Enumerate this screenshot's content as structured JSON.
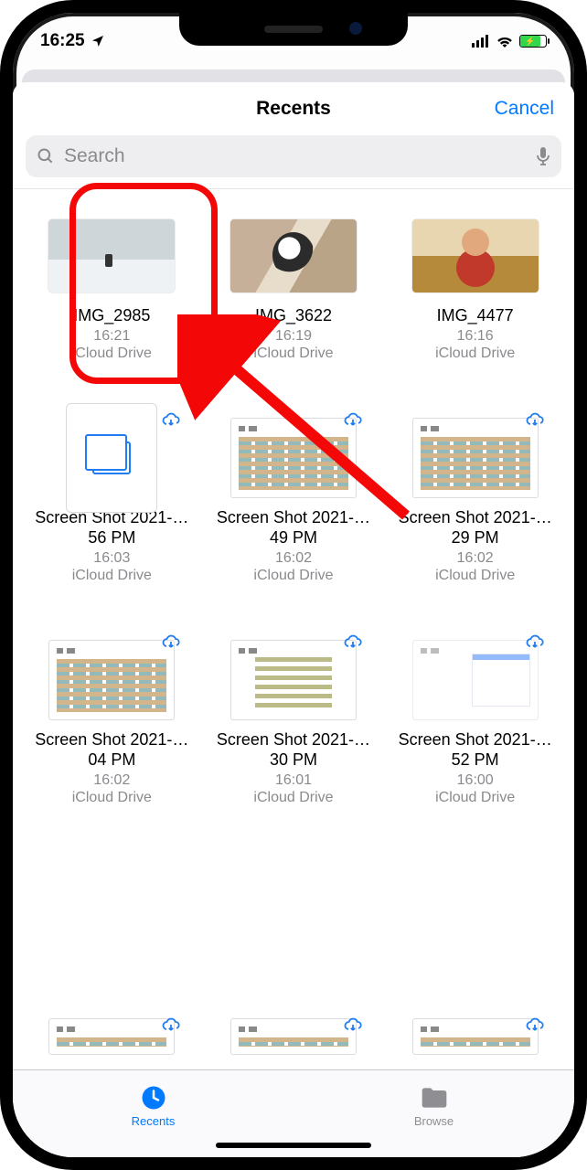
{
  "status": {
    "time": "16:25"
  },
  "nav": {
    "title": "Recents",
    "cancel": "Cancel"
  },
  "search": {
    "placeholder": "Search"
  },
  "files": [
    {
      "name": "IMG_2985",
      "time": "16:21",
      "loc": "iCloud Drive",
      "thumb": "snow",
      "cloud": false,
      "highlighted": true
    },
    {
      "name": "IMG_3622",
      "time": "16:19",
      "loc": "iCloud Drive",
      "thumb": "dog",
      "cloud": false
    },
    {
      "name": "IMG_4477",
      "time": "16:16",
      "loc": "iCloud Drive",
      "thumb": "person",
      "cloud": false
    },
    {
      "name": "Screen Shot 2021-…56 PM",
      "time": "16:03",
      "loc": "iCloud Drive",
      "thumb": "doc",
      "cloud": true
    },
    {
      "name": "Screen Shot 2021-…49 PM",
      "time": "16:02",
      "loc": "iCloud Drive",
      "thumb": "shot-rows",
      "cloud": true
    },
    {
      "name": "Screen Shot 2021-…29 PM",
      "time": "16:02",
      "loc": "iCloud Drive",
      "thumb": "shot-rows",
      "cloud": true
    },
    {
      "name": "Screen Shot 2021-…04 PM",
      "time": "16:02",
      "loc": "iCloud Drive",
      "thumb": "shot-rows",
      "cloud": true
    },
    {
      "name": "Screen Shot 2021-…30 PM",
      "time": "16:01",
      "loc": "iCloud Drive",
      "thumb": "shot-center",
      "cloud": true
    },
    {
      "name": "Screen Shot 2021-…52 PM",
      "time": "16:00",
      "loc": "iCloud Drive",
      "thumb": "shot-right",
      "cloud": true,
      "faded": true
    }
  ],
  "tabs": {
    "recents": "Recents",
    "browse": "Browse"
  }
}
